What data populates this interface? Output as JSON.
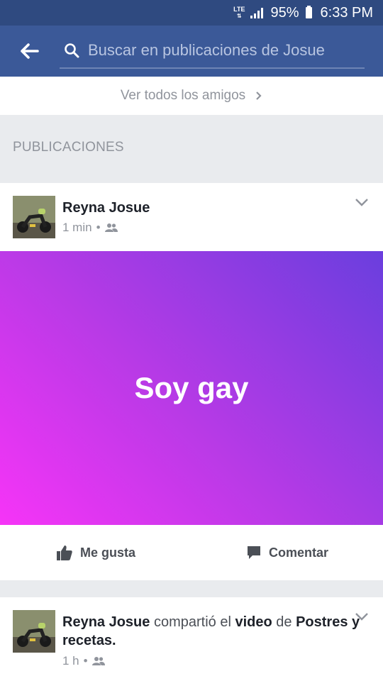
{
  "status_bar": {
    "network": "LTE",
    "battery_percent": "95%",
    "time": "6:33 PM"
  },
  "header": {
    "search_placeholder": "Buscar en publicaciones de Josue",
    "back_icon": "arrow-left-icon",
    "search_icon": "search-icon"
  },
  "friends_link": {
    "label": "Ver todos los amigos"
  },
  "section": {
    "title": "PUBLICACIONES"
  },
  "posts": [
    {
      "author": "Reyna Josue",
      "time": "1 min",
      "audience_icon": "friends-icon",
      "text": "Soy gay",
      "background_gradient": [
        "#f634f7",
        "#6a3ede"
      ],
      "actions": {
        "like": "Me gusta",
        "comment": "Comentar"
      }
    },
    {
      "author": "Reyna Josue",
      "shared_word": "compartió el",
      "video_word": "video",
      "of_word": "de",
      "page": "Postres y recetas.",
      "time": "1 h",
      "audience_icon": "friends-icon"
    }
  ],
  "colors": {
    "header": "#3b5998",
    "status_bar": "#2f4a80",
    "muted_text": "#90949c"
  }
}
